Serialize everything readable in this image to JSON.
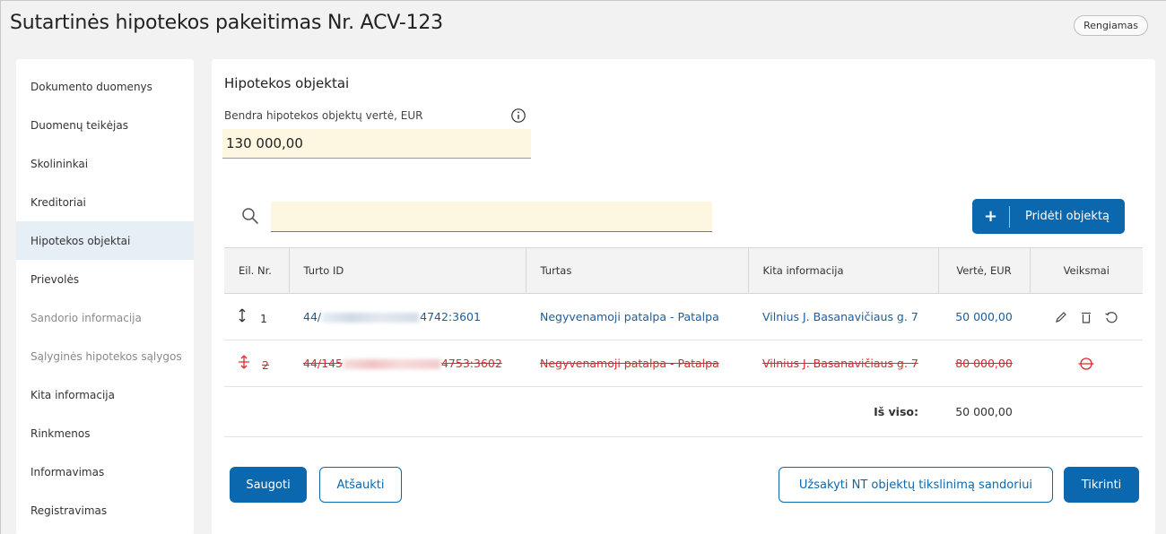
{
  "header": {
    "title": "Sutartinės hipotekos pakeitimas Nr. ACV-123",
    "status": "Rengiamas"
  },
  "sidebar": {
    "items": [
      {
        "label": "Dokumento duomenys"
      },
      {
        "label": "Duomenų teikėjas"
      },
      {
        "label": "Skolininkai"
      },
      {
        "label": "Kreditoriai"
      },
      {
        "label": "Hipotekos objektai"
      },
      {
        "label": "Prievolės"
      },
      {
        "label": "Sandorio informacija"
      },
      {
        "label": "Sąlyginės hipotekos sąlygos"
      },
      {
        "label": "Kita informacija"
      },
      {
        "label": "Rinkmenos"
      },
      {
        "label": "Informavimas"
      },
      {
        "label": "Registravimas"
      }
    ],
    "active_index": 4
  },
  "main": {
    "section_title": "Hipotekos objektai",
    "value_field": {
      "label": "Bendra hipotekos objektų vertė, EUR",
      "value": "130 000,00"
    },
    "search": {
      "value": ""
    },
    "add_button": {
      "icon": "+",
      "label": "Pridėti objektą"
    },
    "table": {
      "columns": [
        "Eil. Nr.",
        "Turto ID",
        "Turtas",
        "Kita informacija",
        "Vertė, EUR",
        "Veiksmai"
      ],
      "rows": [
        {
          "no": "1",
          "id_prefix": "44/",
          "id_suffix": "4742:3601",
          "asset": "Negyvenamoji patalpa - Patalpa",
          "info": "Vilnius J. Basanavičiaus g. 7",
          "value": "50 000,00",
          "deleted": false
        },
        {
          "no": "2",
          "id_prefix": "44/145",
          "id_suffix": "4753:3602",
          "asset": "Negyvenamoji patalpa - Patalpa",
          "info": "Vilnius J. Basanavičiaus g. 7",
          "value": "80 000,00",
          "deleted": true
        }
      ],
      "total_label": "Iš viso:",
      "total_value": "50 000,00"
    },
    "buttons": {
      "save": "Saugoti",
      "cancel": "Atšaukti",
      "order": "Užsakyti NT objektų tikslinimą sandoriui",
      "check": "Tikrinti"
    }
  },
  "colors": {
    "primary": "#0b68ae",
    "deleted": "#e0262b",
    "link": "#1e5c99",
    "field_bg": "#fdf7e2",
    "active_bg": "#e6eef6"
  },
  "icons": [
    "info-icon",
    "search-icon",
    "plus-icon",
    "move-icon",
    "edit-icon",
    "delete-icon",
    "history-icon",
    "restore-icon"
  ]
}
